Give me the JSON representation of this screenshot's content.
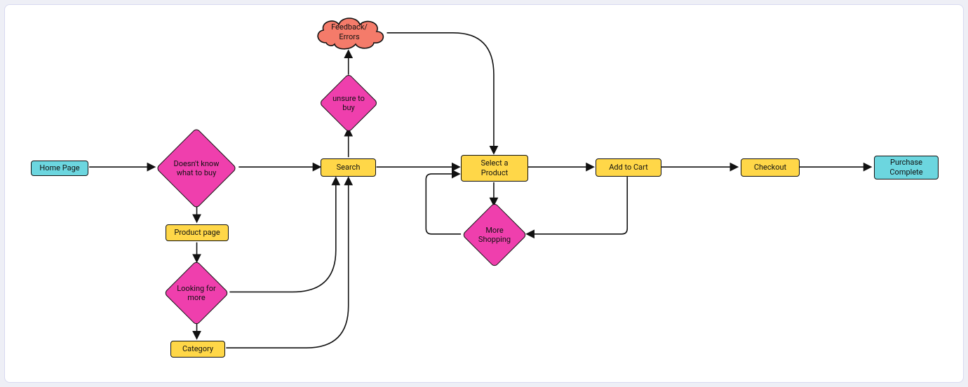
{
  "nodes": {
    "home": {
      "label": "Home Page"
    },
    "doesntknow": {
      "label": "Doesn't know\nwhat to buy"
    },
    "productpage": {
      "label": "Product page"
    },
    "lookingmore": {
      "label": "Looking for\nmore"
    },
    "category": {
      "label": "Category"
    },
    "search": {
      "label": "Search"
    },
    "unsure": {
      "label": "unsure to\nbuy"
    },
    "feedback": {
      "label": "Feedback/\nErrors"
    },
    "select": {
      "label": "Select a\nProduct"
    },
    "moreshopping": {
      "label": "More\nShopping"
    },
    "addtocart": {
      "label": "Add to Cart"
    },
    "checkout": {
      "label": "Checkout"
    },
    "complete": {
      "label": "Purchase\nComplete"
    }
  },
  "flow": {
    "type": "user-flow",
    "start": "home",
    "end": "complete",
    "edges": [
      [
        "home",
        "doesntknow"
      ],
      [
        "doesntknow",
        "search"
      ],
      [
        "doesntknow",
        "productpage"
      ],
      [
        "productpage",
        "lookingmore"
      ],
      [
        "lookingmore",
        "category"
      ],
      [
        "lookingmore",
        "search"
      ],
      [
        "category",
        "search"
      ],
      [
        "search",
        "unsure"
      ],
      [
        "unsure",
        "feedback"
      ],
      [
        "feedback",
        "select"
      ],
      [
        "search",
        "select"
      ],
      [
        "select",
        "moreshopping"
      ],
      [
        "moreshopping",
        "select"
      ],
      [
        "addtocart",
        "moreshopping"
      ],
      [
        "select",
        "addtocart"
      ],
      [
        "addtocart",
        "checkout"
      ],
      [
        "checkout",
        "complete"
      ]
    ]
  },
  "colors": {
    "terminal": "#6cd6df",
    "process": "#ffd748",
    "decision": "#ef3fad",
    "error": "#f47b6a",
    "arrow": "#111111"
  }
}
